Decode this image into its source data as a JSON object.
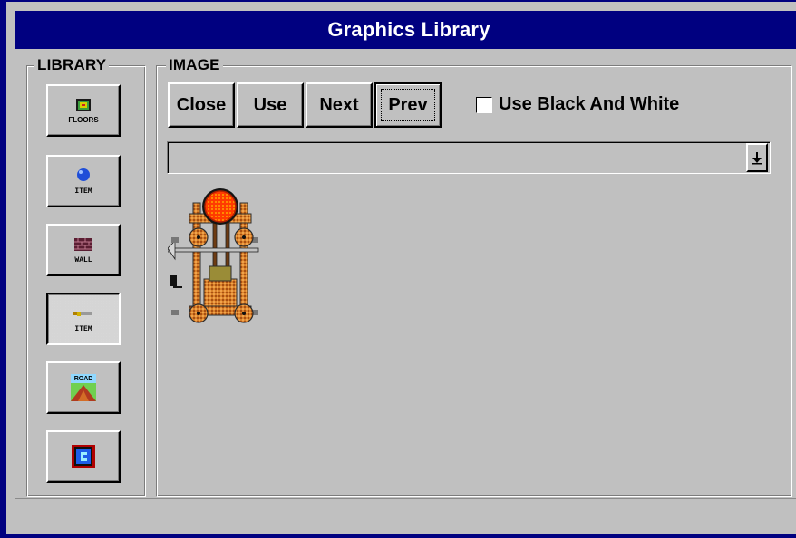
{
  "window": {
    "title": "Graphics Library"
  },
  "groups": {
    "library": "LIBRARY",
    "image": "IMAGE"
  },
  "library_buttons": [
    {
      "label": "FLOORS",
      "icon": "floor-tile-icon",
      "active": false
    },
    {
      "label": "ITEM",
      "icon": "blue-orb-item-icon",
      "active": false
    },
    {
      "label": "WALL",
      "icon": "brick-wall-icon",
      "active": false
    },
    {
      "label": "ITEM",
      "icon": "sword-item-icon",
      "active": true
    },
    {
      "label": "ROAD",
      "icon": "road-icon",
      "active": false
    },
    {
      "label": "",
      "icon": "framed-character-icon",
      "active": false
    }
  ],
  "toolbar": {
    "close_label": "Close",
    "use_label": "Use",
    "next_label": "Next",
    "prev_label": "Prev"
  },
  "options": {
    "black_white_label": "Use Black And White",
    "black_white_checked": false
  },
  "dropdown": {
    "selected_value": "",
    "icon": "dropdown-arrow-icon"
  },
  "preview": {
    "icon": "siege-tower-icon"
  },
  "colors": {
    "titlebar": "#000080",
    "window_bg": "#c0c0c0",
    "accent_orange": "#d9822b",
    "accent_red": "#ff3b00"
  }
}
